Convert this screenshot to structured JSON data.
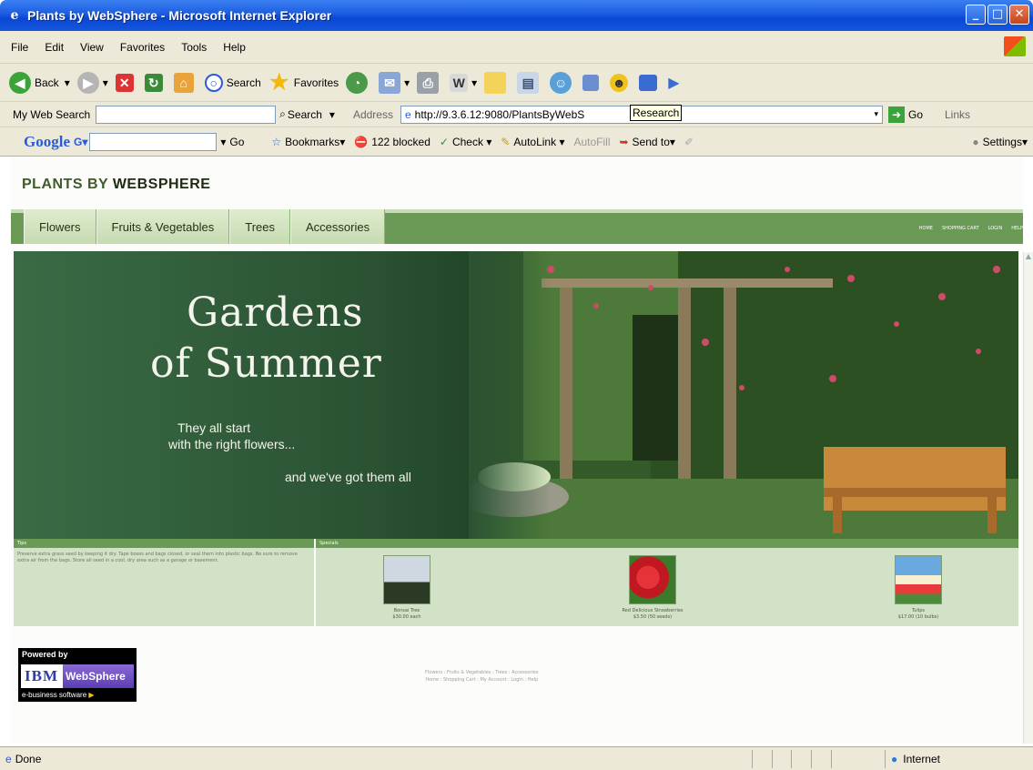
{
  "window": {
    "title": "Plants by WebSphere - Microsoft Internet Explorer"
  },
  "menu": [
    "File",
    "Edit",
    "View",
    "Favorites",
    "Tools",
    "Help"
  ],
  "toolbar": {
    "back": "Back",
    "search": "Search",
    "favorites": "Favorites"
  },
  "searchbar": {
    "label": "My Web Search",
    "search_button": "Search",
    "address_label": "Address",
    "address_value": "http://9.3.6.12:9080/PlantsByWebS",
    "go": "Go",
    "links": "Links",
    "tooltip": "Research"
  },
  "googlebar": {
    "logo": "Google",
    "go": "Go",
    "bookmarks": "Bookmarks",
    "blocked": "122 blocked",
    "check": "Check",
    "autolink": "AutoLink",
    "autofill": "AutoFill",
    "sendto": "Send to",
    "settings": "Settings"
  },
  "site": {
    "logo_prefix": "PLANTS BY ",
    "logo_bold": "WEBSPHERE",
    "tabs": [
      "Flowers",
      "Fruits & Vegetables",
      "Trees",
      "Accessories"
    ],
    "toplinks": [
      "HOME",
      "SHOPPING CART",
      "LOGIN",
      "HELP"
    ]
  },
  "hero": {
    "title_line1": "Gardens",
    "title_line2": "of Summer",
    "line1": "They all start",
    "line2": "with the right flowers...",
    "line3": "and we've got them all"
  },
  "tips": {
    "heading": "Tips",
    "text": "Preserve extra grass seed by keeping it dry. Tape boxes and bags closed, or seal them into plastic bags. Be sure to remove extra air from the bags. Store all seed in a cool, dry area such as a garage or basement."
  },
  "specials": {
    "heading": "Specials",
    "items": [
      {
        "name": "Bonsai Tree",
        "price": "$30.00 each"
      },
      {
        "name": "Red Delicious Strawberries",
        "price": "$3.50 (50 seeds)"
      },
      {
        "name": "Tulips",
        "price": "$17.00 (10 bulbs)"
      }
    ]
  },
  "badge": {
    "powered": "Powered by",
    "ibm": "IBM",
    "websphere": "WebSphere",
    "ebiz": "e-business software"
  },
  "footer": {
    "line1": "Flowers  :  Fruits & Vegetables  :  Trees  :  Accessories",
    "line2": "Home  :  Shopping Cart  :  My Account  :  Login  :  Help"
  },
  "status": {
    "text": "Done",
    "zone": "Internet"
  }
}
